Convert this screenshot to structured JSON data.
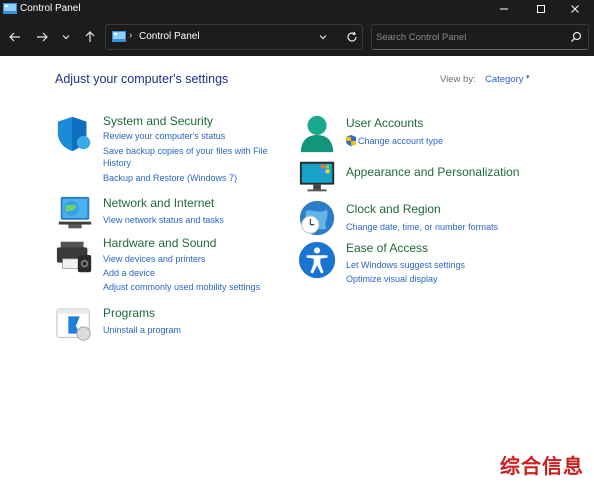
{
  "window": {
    "title": "Control Panel"
  },
  "address_bar": {
    "path": "Control Panel"
  },
  "search": {
    "placeholder": "Search Control Panel"
  },
  "main": {
    "heading": "Adjust your computer's settings",
    "view_by_label": "View by:",
    "view_by_value": "Category"
  },
  "categories": {
    "system_security": {
      "title": "System and Security",
      "icon": "shield-icon",
      "links": [
        "Review your computer's status",
        "Save backup copies of your files with File",
        "History",
        "Backup and Restore (Windows 7)"
      ]
    },
    "network": {
      "title": "Network and Internet",
      "icon": "network-icon",
      "links": [
        "View network status and tasks"
      ]
    },
    "hardware": {
      "title": "Hardware and Sound",
      "icon": "printer-icon",
      "links": [
        "View devices and printers",
        "Add a device",
        "Adjust commonly used mobility settings"
      ]
    },
    "programs": {
      "title": "Programs",
      "icon": "programs-icon",
      "links": [
        "Uninstall a program"
      ]
    },
    "user_accounts": {
      "title": "User Accounts",
      "icon": "user-icon",
      "links": [
        "Change account type"
      ]
    },
    "appearance": {
      "title": "Appearance and Personalization",
      "icon": "monitor-icon",
      "links": []
    },
    "clock": {
      "title": "Clock and Region",
      "icon": "clock-icon",
      "links": [
        "Change date, time, or number formats"
      ]
    },
    "ease": {
      "title": "Ease of Access",
      "icon": "accessibility-icon",
      "links": [
        "Let Windows suggest settings",
        "Optimize visual display"
      ]
    }
  },
  "watermark": "综合信息",
  "colors": {
    "titlebar_bg": "#1c1c1c",
    "heading": "#1e3287",
    "category_title": "#1e6b3a",
    "link": "#2b67c5"
  }
}
